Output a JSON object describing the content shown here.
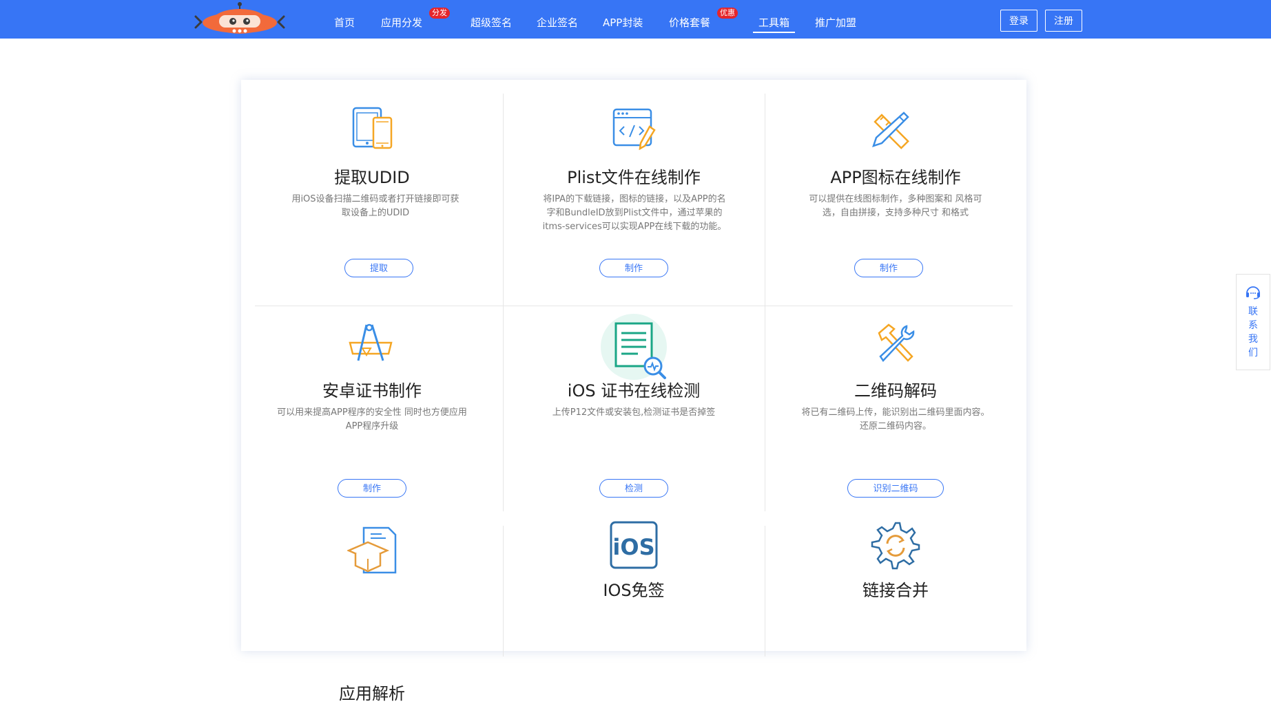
{
  "colors": {
    "brand": "#3775f5",
    "badge": "#e5252b",
    "logo": "#f26a3b"
  },
  "nav": {
    "items": [
      {
        "label": "首页"
      },
      {
        "label": "应用分发",
        "badge": "分发"
      },
      {
        "label": "超级签名"
      },
      {
        "label": "企业签名"
      },
      {
        "label": "APP封装"
      },
      {
        "label": "价格套餐",
        "badge": "优惠"
      },
      {
        "label": "工具箱",
        "active": true
      },
      {
        "label": "推广加盟"
      }
    ],
    "login_label": "登录",
    "register_label": "注册"
  },
  "tools": [
    {
      "icon": "devices-icon",
      "title": "提取UDID",
      "desc": "用iOS设备扫描二维码或者打开链接即可获取设备上的UDID",
      "button": "提取"
    },
    {
      "icon": "code-window-icon",
      "title": "Plist文件在线制作",
      "desc": "将IPA的下载链接，图标的链接，以及APP的名字和BundleID放到Plist文件中，通过苹果的itms-services可以实现APP在线下载的功能。",
      "button": "制作"
    },
    {
      "icon": "ruler-pencil-icon",
      "title": "APP图标在线制作",
      "desc": "可以提供在线图标制作，多种图案和 风格可选，自由拼接，支持多种尺寸 和格式",
      "button": "制作"
    },
    {
      "icon": "compass-ruler-icon",
      "title": "安卓证书制作",
      "desc": "可以用来提高APP程序的安全性 同时也方便应用APP程序升级",
      "button": "制作"
    },
    {
      "icon": "document-search-icon",
      "title": "iOS 证书在线检测",
      "desc": "上传P12文件或安装包,检测证书是否掉签",
      "button": "检测"
    },
    {
      "icon": "hammer-wrench-icon",
      "title": "二维码解码",
      "desc": "将已有二维码上传，能识别出二维码里面内容。 还原二维码内容。",
      "button": "识别二维码"
    },
    {
      "icon": "graduation-cap-icon",
      "title": "应用解析"
    },
    {
      "icon": "ios-badge-icon",
      "title": "IOS免签"
    },
    {
      "icon": "gear-sync-icon",
      "title": "链接合并"
    }
  ],
  "side": {
    "icon": "headset-icon",
    "label_chars": [
      "联",
      "系",
      "我",
      "们"
    ]
  }
}
